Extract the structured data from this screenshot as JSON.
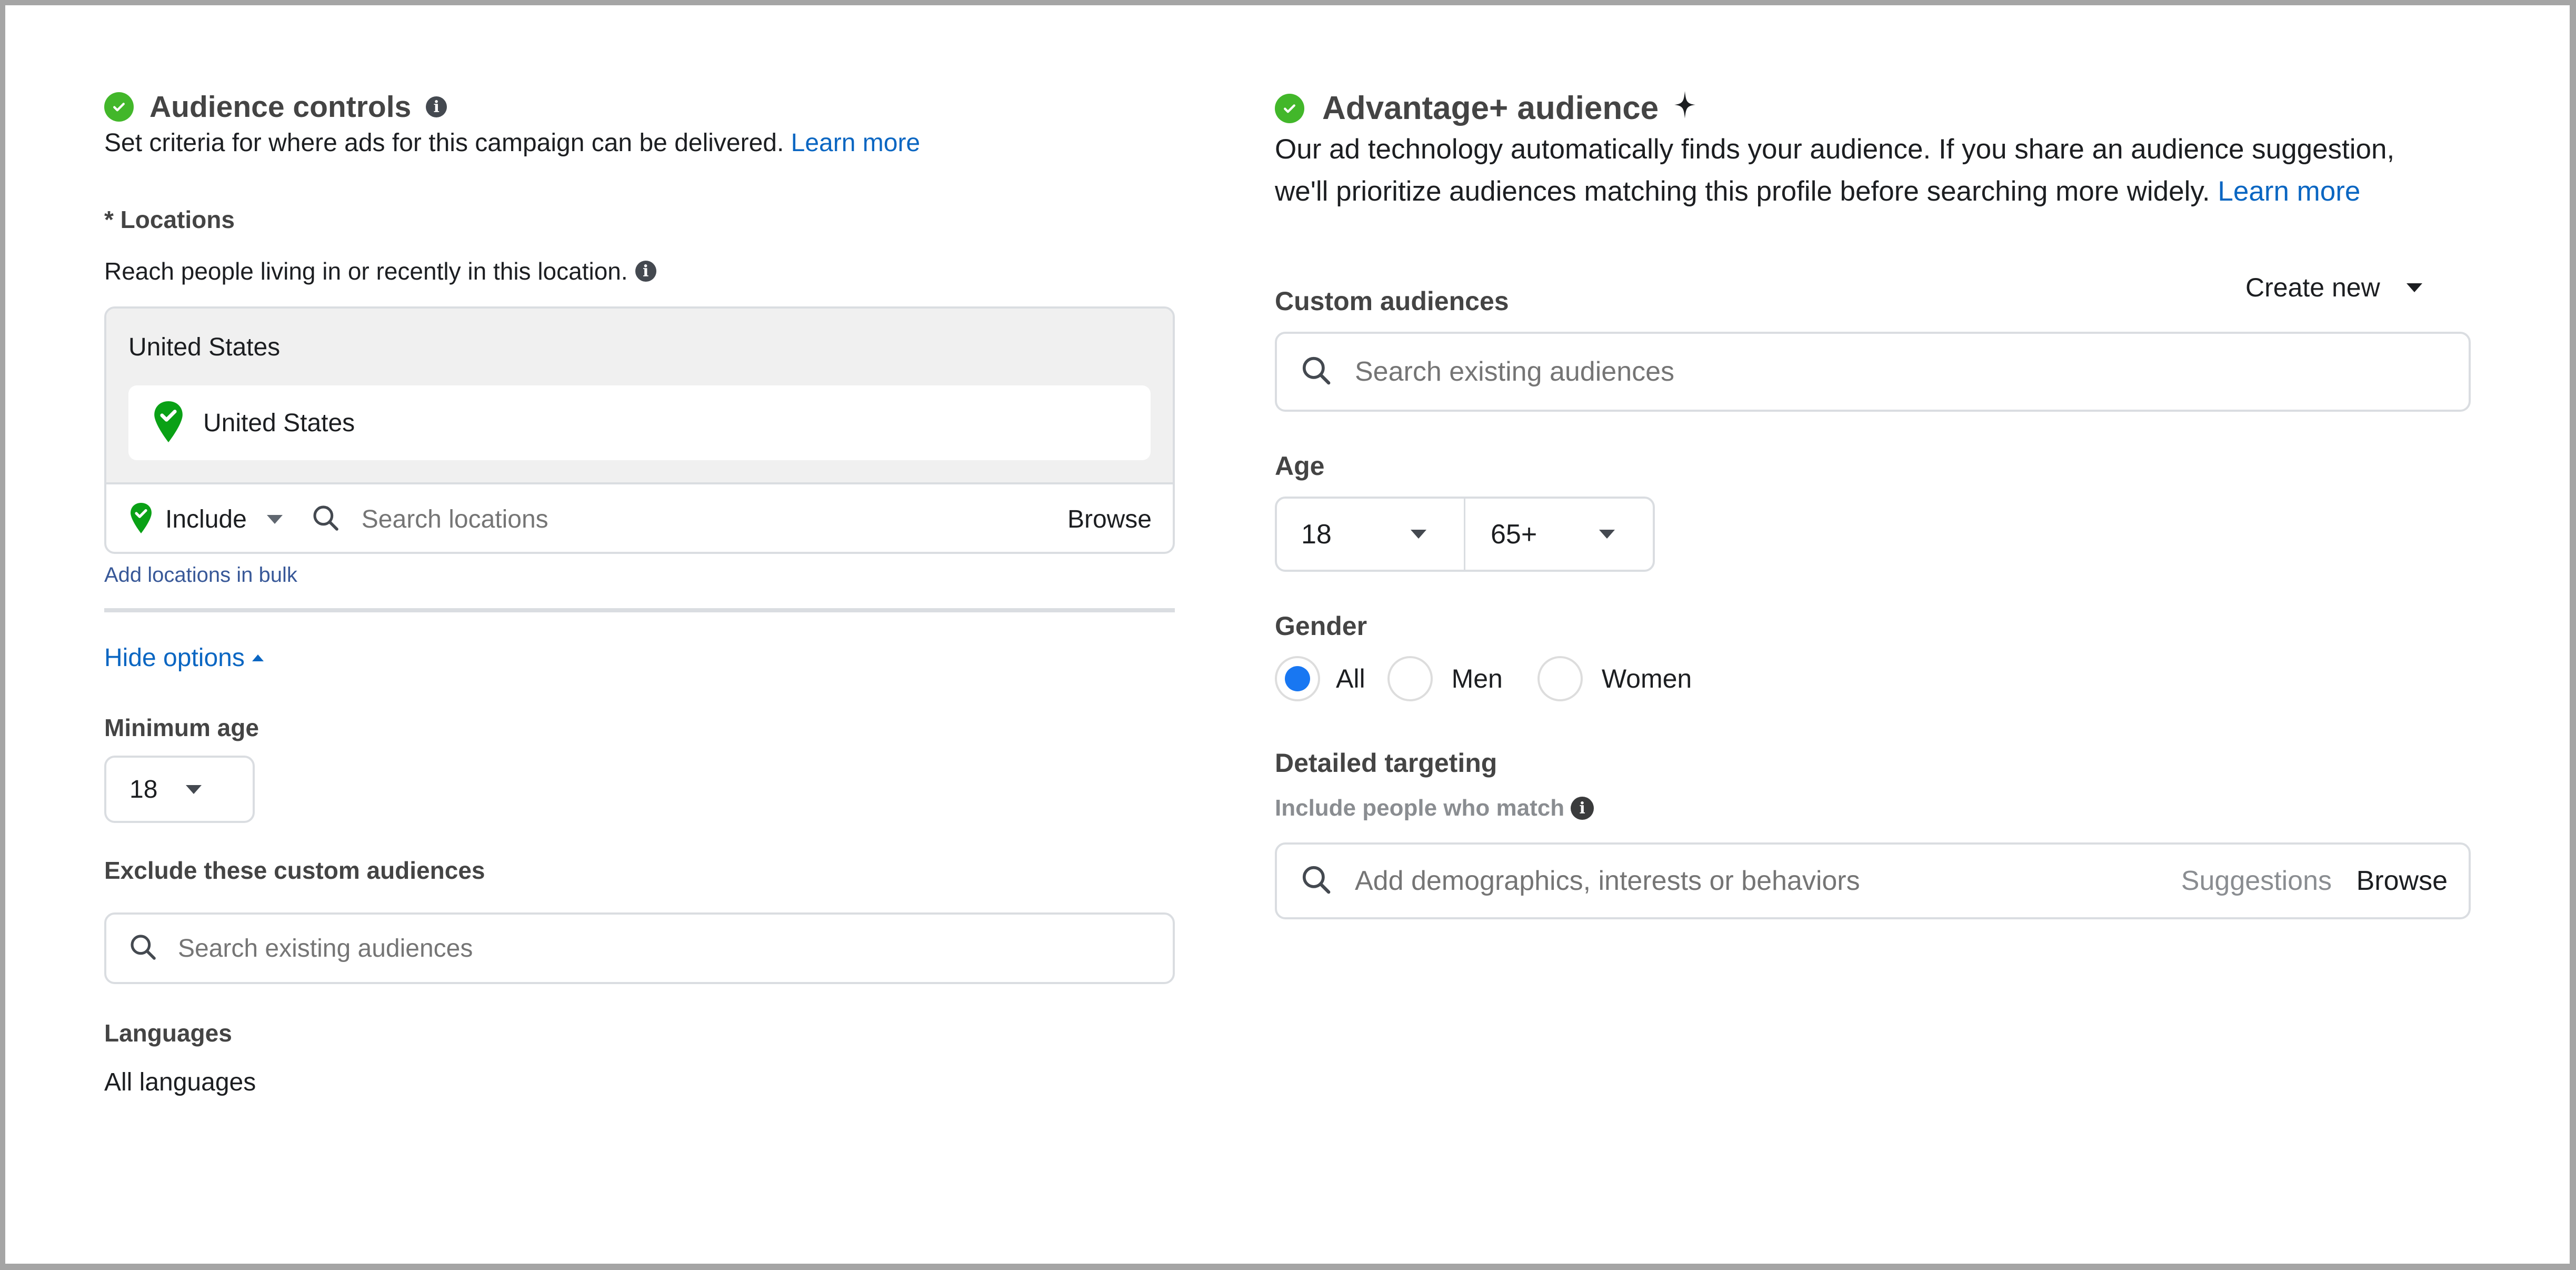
{
  "left": {
    "title": "Audience controls",
    "description": "Set criteria for where ads for this campaign can be delivered.",
    "learn_more": "Learn more",
    "locations": {
      "label": "* Locations",
      "helper": "Reach people living in or recently in this location.",
      "group_title": "United States",
      "selected_items": [
        "United States"
      ],
      "include_label": "Include",
      "search_placeholder": "Search locations",
      "browse_label": "Browse",
      "bulk_link": "Add locations in bulk"
    },
    "hide_options": "Hide options",
    "minimum_age": {
      "label": "Minimum age",
      "value": "18"
    },
    "exclude": {
      "label": "Exclude these custom audiences",
      "placeholder": "Search existing audiences"
    },
    "languages": {
      "label": "Languages",
      "value": "All languages"
    }
  },
  "right": {
    "title": "Advantage+ audience",
    "description_line1": "Our ad technology automatically finds your audience. If you share an audience suggestion,",
    "description_line2": "we'll prioritize audiences matching this profile before searching more widely.",
    "learn_more": "Learn more",
    "custom_audiences": {
      "label": "Custom audiences",
      "create_new": "Create new",
      "placeholder": "Search existing audiences"
    },
    "age": {
      "label": "Age",
      "min": "18",
      "max": "65+"
    },
    "gender": {
      "label": "Gender",
      "options": [
        "All",
        "Men",
        "Women"
      ],
      "selected": "All"
    },
    "detailed_targeting": {
      "label": "Detailed targeting",
      "helper": "Include people who match",
      "placeholder": "Add demographics, interests or behaviors",
      "suggestions": "Suggestions",
      "browse": "Browse"
    }
  },
  "colors": {
    "success_green": "#42b72a",
    "pin_green": "#0aa116",
    "link_blue": "#0a66c2",
    "radio_blue": "#1877f2"
  }
}
